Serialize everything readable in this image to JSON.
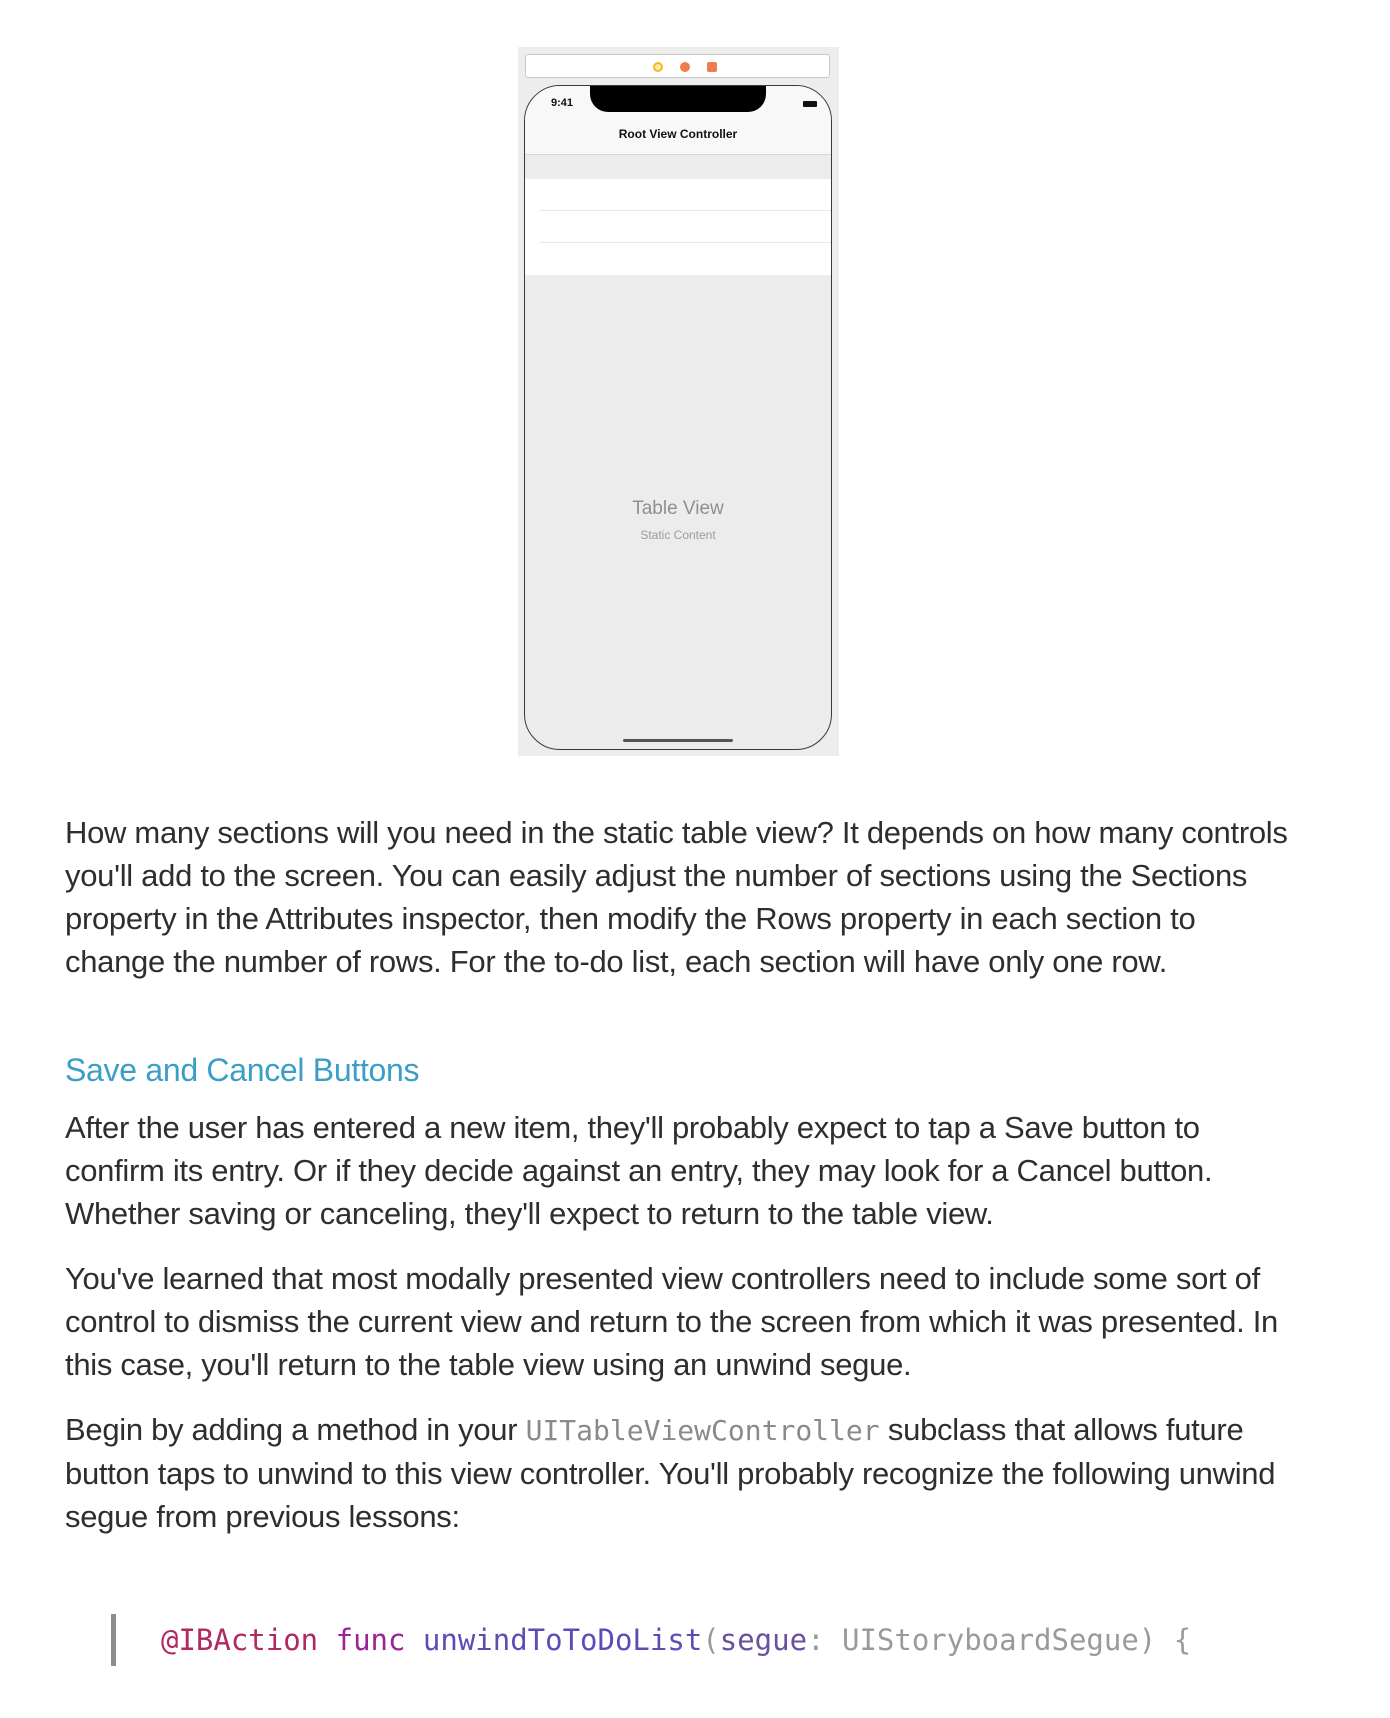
{
  "figure": {
    "status_time": "9:41",
    "nav_title": "Root View Controller",
    "table_label": "Table View",
    "table_sublabel": "Static Content"
  },
  "paragraphs": {
    "p1": "How many sections will you need in the static table view? It depends on how many controls you'll add to the screen. You can easily adjust the number of sections using the Sections property in the Attributes inspector, then modify the Rows property in each section to change the number of rows. For the to-do list, each section will have only one row.",
    "heading": "Save and Cancel Buttons",
    "p2": "After the user has entered a new item, they'll probably expect to tap a Save button to confirm its entry. Or if they decide against an entry, they may look for a Cancel button. Whether saving or canceling, they'll expect to return to the table view.",
    "p3": "You've learned that most modally presented view controllers need to include some sort of control to dismiss the current view and return to the screen from which it was presented. In this case, you'll return to the table view using an unwind segue.",
    "p4_before": "Begin by adding a method in your ",
    "p4_code": "UITableViewController",
    "p4_after": " subclass that allows future button taps to unwind to this view controller. You'll probably recognize the following unwind segue from previous lessons:"
  },
  "code": {
    "attr": "@IBAction",
    "keyword": "func",
    "function": "unwindToToDoList",
    "open_paren": "(",
    "param": "segue",
    "colon": ": ",
    "type": "UIStoryboardSegue",
    "close": ") {"
  },
  "colors": {
    "heading": "#3b9ec7",
    "code_attr": "#b0295f",
    "code_keyword": "#9b2393",
    "code_function": "#5f4bb6"
  }
}
